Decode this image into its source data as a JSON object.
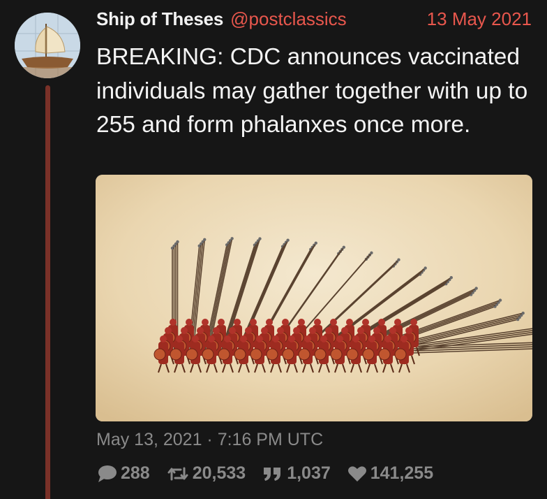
{
  "author": {
    "display_name": "Ship of Theses",
    "handle": "@postclassics",
    "avatar_icon": "ship-avatar-icon"
  },
  "date": "13 May 2021",
  "text": "BREAKING: CDC announces vaccinated individuals may gather together with up to 255 and form phalanxes once more.",
  "media": {
    "icon": "phalanx-illustration"
  },
  "timestamp": "May 13, 2021 · 7:16 PM UTC",
  "stats": {
    "replies": "288",
    "retweets": "20,533",
    "quotes": "1,037",
    "likes": "141,255"
  },
  "colors": {
    "background": "#161616",
    "accent": "#e8574d",
    "thread_line": "#7a3128",
    "muted": "#8a8a8a"
  }
}
